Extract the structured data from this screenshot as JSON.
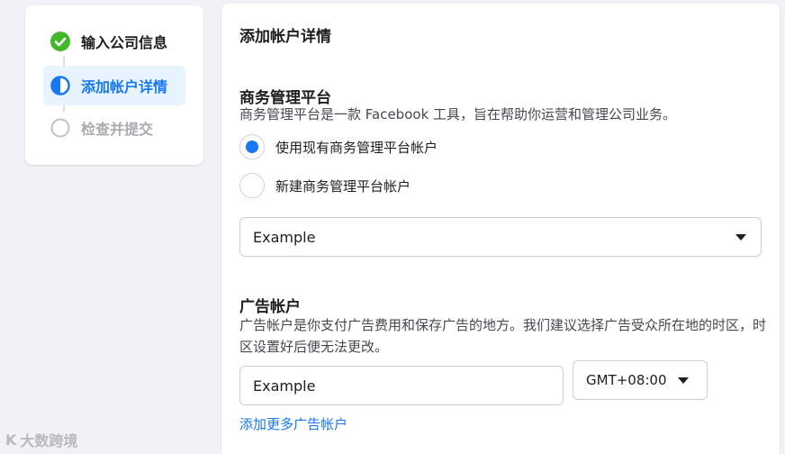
{
  "stepper": {
    "steps": [
      {
        "label": "输入公司信息",
        "status": "done",
        "icon": "check-circle-icon"
      },
      {
        "label": "添加帐户详情",
        "status": "active",
        "icon": "half-circle-icon"
      },
      {
        "label": "检查并提交",
        "status": "pending",
        "icon": "empty-circle-icon"
      }
    ]
  },
  "panel": {
    "title": "添加帐户详情",
    "business": {
      "title": "商务管理平台",
      "desc": "商务管理平台是一款 Facebook 工具，旨在帮助你运营和管理公司业务。",
      "options": [
        {
          "label": "使用现有商务管理平台帐户",
          "checked": true
        },
        {
          "label": "新建商务管理平台帐户",
          "checked": false
        }
      ],
      "select_value": "Example"
    },
    "ad_account": {
      "title": "广告帐户",
      "desc": "广告帐户是你支付广告费用和保存广告的地方。我们建议选择广告受众所在地的时区，时区设置好后便无法更改。",
      "name_placeholder": "Example",
      "timezone": "GMT+08:00",
      "add_more": "添加更多广告帐户"
    }
  },
  "watermark": {
    "text": "大数跨境",
    "logo_text": "K"
  },
  "colors": {
    "accent": "#1877f2",
    "success": "#42b72a",
    "active_bg": "#e7f3ff"
  }
}
